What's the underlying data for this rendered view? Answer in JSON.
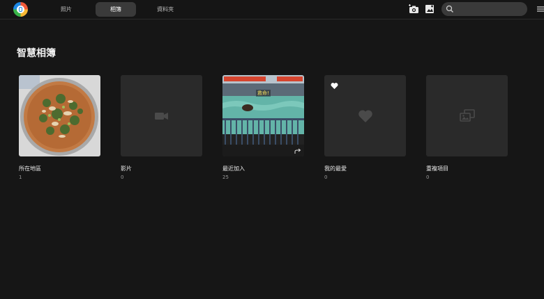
{
  "app": {
    "tabs": [
      {
        "label": "照片",
        "active": false
      },
      {
        "label": "相簿",
        "active": true
      },
      {
        "label": "資料夾",
        "active": false
      }
    ],
    "search": {
      "placeholder": ""
    },
    "icons": [
      "app-logo-icon",
      "camera-add-icon",
      "add-photo-icon",
      "search-icon",
      "menu-icon"
    ]
  },
  "section": {
    "title": "智慧相簿"
  },
  "albums": [
    {
      "name": "所在地區",
      "count": "1",
      "thumbnail": "food-photo"
    },
    {
      "name": "影片",
      "count": "0",
      "thumbnail": "video-placeholder-icon"
    },
    {
      "name": "最近加入",
      "count": "25",
      "thumbnail": "pool-photo",
      "caption": "救命!"
    },
    {
      "name": "我的最愛",
      "count": "0",
      "thumbnail": "heart-placeholder-icon"
    },
    {
      "name": "重複項目",
      "count": "0",
      "thumbnail": "duplicate-placeholder-icon"
    }
  ],
  "colors": {
    "background": "#161616",
    "active_tab": "#3a3a3a",
    "tile": "#2a2a2a"
  }
}
